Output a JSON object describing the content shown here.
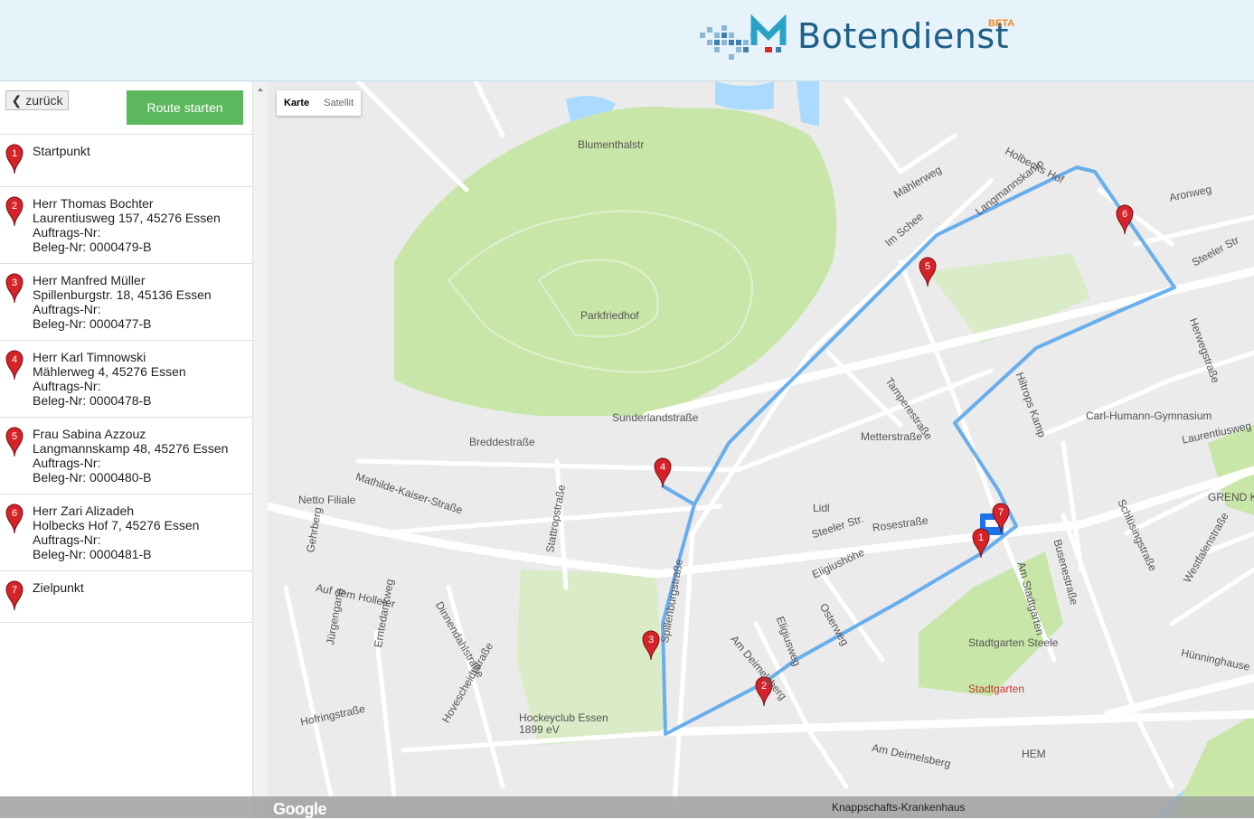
{
  "header": {
    "logo_text": "Botendienst",
    "logo_badge": "BETA"
  },
  "sidebar": {
    "back_label": "zurück",
    "start_route_label": "Route starten",
    "stops": [
      {
        "n": "1",
        "lines": [
          "Startpunkt"
        ]
      },
      {
        "n": "2",
        "lines": [
          "Herr Thomas Bochter",
          "Laurentiusweg 157, 45276 Essen",
          "Auftrags-Nr:",
          "Beleg-Nr: 0000479-B"
        ]
      },
      {
        "n": "3",
        "lines": [
          "Herr Manfred Müller",
          "Spillenburgstr. 18, 45136 Essen",
          "Auftrags-Nr:",
          "Beleg-Nr: 0000477-B"
        ]
      },
      {
        "n": "4",
        "lines": [
          "Herr Karl Timnowski",
          "Mählerweg 4, 45276 Essen",
          "Auftrags-Nr:",
          "Beleg-Nr: 0000478-B"
        ]
      },
      {
        "n": "5",
        "lines": [
          "Frau Sabina Azzouz",
          "Langmannskamp 48, 45276 Essen",
          "Auftrags-Nr:",
          "Beleg-Nr: 0000480-B"
        ]
      },
      {
        "n": "6",
        "lines": [
          "Herr Zari Alizadeh",
          "Holbecks Hof 7, 45276 Essen",
          "Auftrags-Nr:",
          "Beleg-Nr: 0000481-B"
        ]
      },
      {
        "n": "7",
        "lines": [
          "Zielpunkt"
        ]
      }
    ]
  },
  "map": {
    "toggle_map": "Karte",
    "toggle_satellite": "Satellit",
    "attribution": "Google",
    "labels": [
      {
        "text": "Blumenthalstr",
        "id": "l1"
      },
      {
        "text": "Parkfriedhof",
        "id": "l2"
      },
      {
        "text": "Holbecks Hof",
        "id": "l3"
      },
      {
        "text": "Aronweg",
        "id": "l4"
      },
      {
        "text": "Mählerweg",
        "id": "l5"
      },
      {
        "text": "Im Schee",
        "id": "l6"
      },
      {
        "text": "Langmannskamp",
        "id": "l7"
      },
      {
        "text": "Steeler Str",
        "id": "l8"
      },
      {
        "text": "Herwegstraße",
        "id": "l9"
      },
      {
        "text": "Tamperestraße",
        "id": "l10"
      },
      {
        "text": "Hiltrops Kamp",
        "id": "l11"
      },
      {
        "text": "Carl-Humann-Gymnasium",
        "id": "l12"
      },
      {
        "text": "Laurentiusweg",
        "id": "l13"
      },
      {
        "text": "Sunderlandstraße",
        "id": "l14"
      },
      {
        "text": "Breddestraße",
        "id": "l15"
      },
      {
        "text": "Metterstraße",
        "id": "l16"
      },
      {
        "text": "Mathilde-Kaiser-Straße",
        "id": "l17"
      },
      {
        "text": "Netto Filiale",
        "id": "l18"
      },
      {
        "text": "Lidl",
        "id": "l19"
      },
      {
        "text": "Rosestraße",
        "id": "l20"
      },
      {
        "text": "GREND K",
        "id": "l21"
      },
      {
        "text": "Steeler Str.",
        "id": "l22"
      },
      {
        "text": "Stattropstraße",
        "id": "l23"
      },
      {
        "text": "Gehrberg",
        "id": "l24"
      },
      {
        "text": "Auf dem Holleter",
        "id": "l25"
      },
      {
        "text": "Dinnendahlstraße",
        "id": "l26"
      },
      {
        "text": "Eligiushöhe",
        "id": "l27"
      },
      {
        "text": "Osterweg",
        "id": "l28"
      },
      {
        "text": "Eligiusweg",
        "id": "l29"
      },
      {
        "text": "Am Deimelsberg",
        "id": "l30"
      },
      {
        "text": "Stadtgarten Steele",
        "id": "l31"
      },
      {
        "text": "Stadtgarten",
        "id": "l32"
      },
      {
        "text": "Busenestraße",
        "id": "l33"
      },
      {
        "text": "Schlüsingstraße",
        "id": "l34"
      },
      {
        "text": "Westfalenstraße",
        "id": "l35"
      },
      {
        "text": "Hünninghause",
        "id": "l36"
      },
      {
        "text": "Hockeyclub Essen 1899 eV",
        "id": "l37"
      },
      {
        "text": "Hovescheidtstraße",
        "id": "l38"
      },
      {
        "text": "Hofringstraße",
        "id": "l39"
      },
      {
        "text": "Jürgengang",
        "id": "l40"
      },
      {
        "text": "Erntedankweg",
        "id": "l41"
      },
      {
        "text": "HEM",
        "id": "l42"
      },
      {
        "text": "Am Deimelsberg",
        "id": "l43"
      },
      {
        "text": "Spillenburgstraße",
        "id": "l44"
      },
      {
        "text": "Am Stadtgarten",
        "id": "l45"
      }
    ],
    "bottom_poi": "Knappschafts-Krankenhaus"
  },
  "colors": {
    "route": "#5ba7ec",
    "park": "#c8e6a8",
    "pin": "#d5232a",
    "start_button": "#5cb85c"
  }
}
